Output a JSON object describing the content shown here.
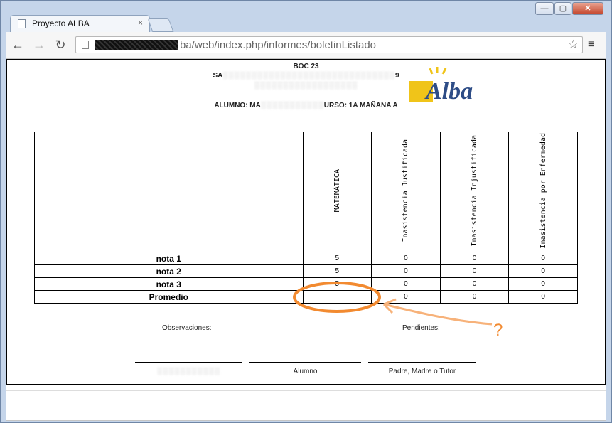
{
  "browser": {
    "tab_title": "Proyecto ALBA",
    "tab_close": "×",
    "url_visible": "ba/web/index.php/informes/boletinListado",
    "back_icon": "←",
    "forward_icon": "→",
    "reload_icon": "↻",
    "star_icon": "☆",
    "menu_icon": "≡",
    "minimize": "—",
    "maximize": "▢",
    "close": "✕"
  },
  "report": {
    "header_top": "BOC 23",
    "header_line2_prefix": "SA",
    "header_line2_suffix": "9",
    "student_prefix": "ALUMNO: MA",
    "course": "URSO: 1A MAÑANA A",
    "logo_text": "Alba",
    "columns": [
      "MATEMÁTICA",
      "Inasistencia Justificada",
      "Inasistencia Injustificada",
      "Inasistencia por Enfermedad"
    ],
    "rows": [
      {
        "label": "nota 1",
        "values": [
          "5",
          "0",
          "0",
          "0"
        ]
      },
      {
        "label": "nota 2",
        "values": [
          "5",
          "0",
          "0",
          "0"
        ]
      },
      {
        "label": "nota 3",
        "values": [
          "5",
          "0",
          "0",
          "0"
        ]
      },
      {
        "label": "Promedio",
        "values": [
          "",
          "0",
          "0",
          "0"
        ]
      }
    ],
    "observaciones_label": "Observaciones:",
    "pendientes_label": "Pendientes:",
    "signatures": [
      "Alumno",
      "Padre, Madre o Tutor"
    ]
  },
  "annotation": {
    "question_mark": "?",
    "color": "#f28a30"
  }
}
